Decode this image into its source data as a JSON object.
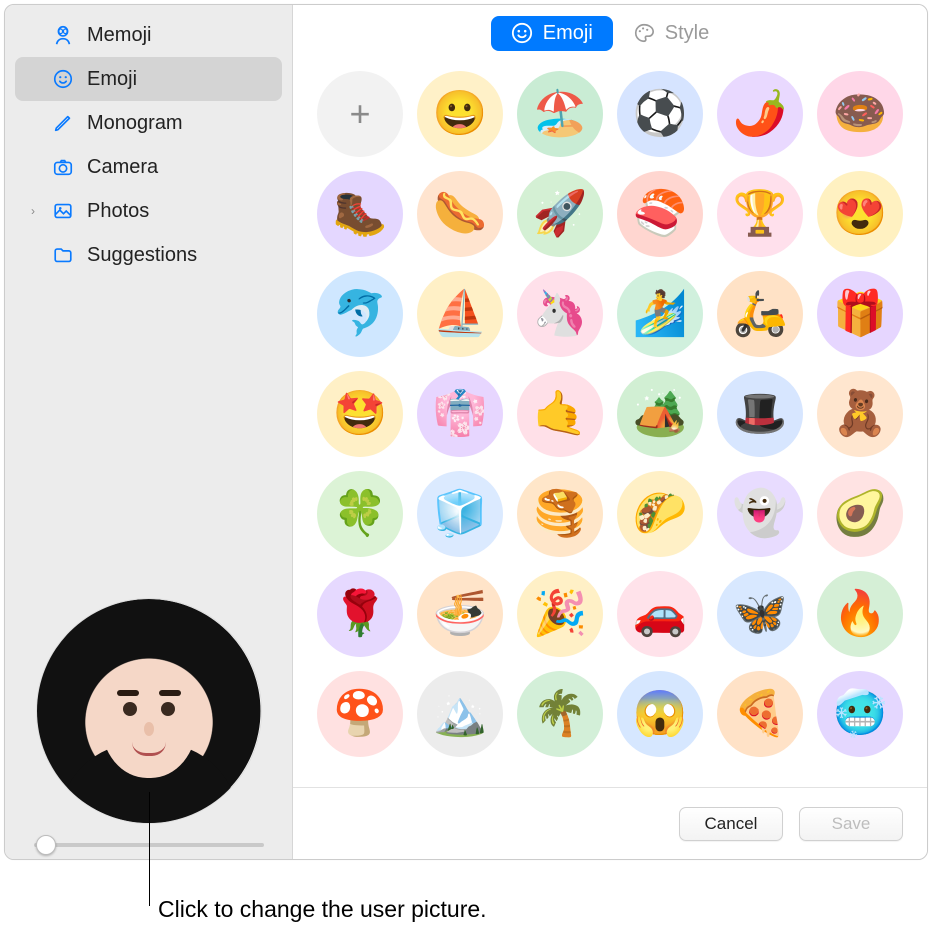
{
  "sidebar": {
    "items": [
      {
        "id": "memoji",
        "label": "Memoji",
        "icon": "memoji-icon",
        "icon_color": "#0a7aff",
        "selected": false,
        "expandable": false
      },
      {
        "id": "emoji",
        "label": "Emoji",
        "icon": "emoji-icon",
        "icon_color": "#0a7aff",
        "selected": true,
        "expandable": false
      },
      {
        "id": "monogram",
        "label": "Monogram",
        "icon": "pencil-icon",
        "icon_color": "#0a7aff",
        "selected": false,
        "expandable": false
      },
      {
        "id": "camera",
        "label": "Camera",
        "icon": "camera-icon",
        "icon_color": "#0a7aff",
        "selected": false,
        "expandable": false
      },
      {
        "id": "photos",
        "label": "Photos",
        "icon": "photos-icon",
        "icon_color": "#0a7aff",
        "selected": false,
        "expandable": true
      },
      {
        "id": "suggestions",
        "label": "Suggestions",
        "icon": "folder-icon",
        "icon_color": "#0a7aff",
        "selected": false,
        "expandable": false
      }
    ]
  },
  "tabs": {
    "emoji_label": "Emoji",
    "style_label": "Style",
    "active": "emoji"
  },
  "grid": {
    "add_label": "+",
    "items": [
      {
        "glyph": "😀",
        "bg": "#fff1c8"
      },
      {
        "glyph": "🏖️",
        "bg": "#c9ecd4"
      },
      {
        "glyph": "⚽",
        "bg": "#d6e4ff"
      },
      {
        "glyph": "🌶️",
        "bg": "#e9d9ff"
      },
      {
        "glyph": "🍩",
        "bg": "#ffd7e8"
      },
      {
        "glyph": "🥾",
        "bg": "#e4d7ff"
      },
      {
        "glyph": "🌭",
        "bg": "#ffe4cf"
      },
      {
        "glyph": "🚀",
        "bg": "#d4f0d4"
      },
      {
        "glyph": "🍣",
        "bg": "#ffd6d0"
      },
      {
        "glyph": "🏆",
        "bg": "#ffe0ec"
      },
      {
        "glyph": "😍",
        "bg": "#fff1c1"
      },
      {
        "glyph": "🐬",
        "bg": "#cfe7ff"
      },
      {
        "glyph": "⛵",
        "bg": "#fff0c6"
      },
      {
        "glyph": "🦄",
        "bg": "#ffe0ea"
      },
      {
        "glyph": "🏄",
        "bg": "#d0f0dd"
      },
      {
        "glyph": "🛵",
        "bg": "#ffe2c6"
      },
      {
        "glyph": "🎁",
        "bg": "#e6d6ff"
      },
      {
        "glyph": "🤩",
        "bg": "#fff0c6"
      },
      {
        "glyph": "👘",
        "bg": "#e7d6ff"
      },
      {
        "glyph": "🤙",
        "bg": "#ffe0e8"
      },
      {
        "glyph": "🏕️",
        "bg": "#d1efd3"
      },
      {
        "glyph": "🎩",
        "bg": "#d7e6ff"
      },
      {
        "glyph": "🧸",
        "bg": "#ffe6cf"
      },
      {
        "glyph": "🍀",
        "bg": "#dcf3d6"
      },
      {
        "glyph": "🧊",
        "bg": "#dbeaff"
      },
      {
        "glyph": "🥞",
        "bg": "#ffe6c9"
      },
      {
        "glyph": "🌮",
        "bg": "#fff0c6"
      },
      {
        "glyph": "👻",
        "bg": "#e8dcff"
      },
      {
        "glyph": "🥑",
        "bg": "#ffe3e3"
      },
      {
        "glyph": "🌹",
        "bg": "#e6d9ff"
      },
      {
        "glyph": "🍜",
        "bg": "#ffe4c9"
      },
      {
        "glyph": "🎉",
        "bg": "#fff0c6"
      },
      {
        "glyph": "🚗",
        "bg": "#ffe2ea"
      },
      {
        "glyph": "🦋",
        "bg": "#d8e8ff"
      },
      {
        "glyph": "🔥",
        "bg": "#d5efd6"
      },
      {
        "glyph": "🍄",
        "bg": "#ffe1e1"
      },
      {
        "glyph": "🏔️",
        "bg": "#ececec"
      },
      {
        "glyph": "🌴",
        "bg": "#d3efd8"
      },
      {
        "glyph": "😱",
        "bg": "#d6e7ff"
      },
      {
        "glyph": "🍕",
        "bg": "#ffe2c7"
      },
      {
        "glyph": "🥶",
        "bg": "#e4d7ff"
      }
    ]
  },
  "footer": {
    "cancel_label": "Cancel",
    "save_label": "Save",
    "save_enabled": false
  },
  "zoom": {
    "value": 0,
    "min": 0,
    "max": 100
  },
  "callout": {
    "text": "Click to change the user picture."
  }
}
